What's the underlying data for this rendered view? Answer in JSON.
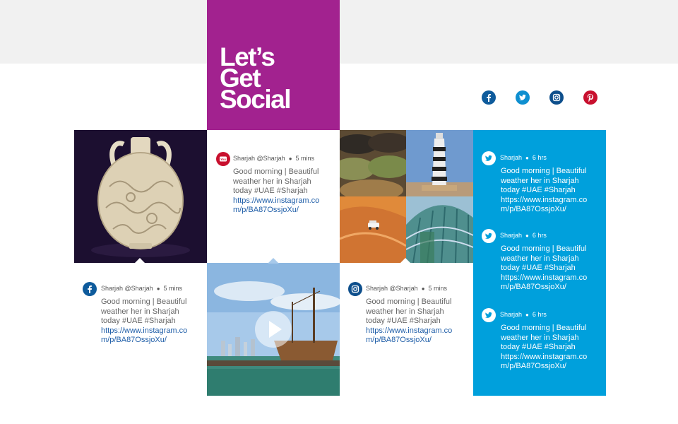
{
  "header": {
    "title_lines": [
      "Let’s",
      "Get",
      "Social"
    ]
  },
  "social_icons": [
    {
      "name": "facebook-icon",
      "color": "#0e5b9c"
    },
    {
      "name": "twitter-icon",
      "color": "#0e8fd0"
    },
    {
      "name": "instagram-icon",
      "color": "#0e4f8c"
    },
    {
      "name": "pinterest-icon",
      "color": "#c8102e"
    }
  ],
  "colors": {
    "title_block": "#a2228f",
    "twitter_panel": "#00a0dc",
    "link": "#1f5ea8"
  },
  "posts": {
    "youtube": {
      "author": "Sharjah @Sharjah",
      "time": "5 mins",
      "message": "Good morning | Beautiful weather her in Sharjah today #UAE #Sharjah",
      "link": "https://www.instagram.com/p/BA87OssjoXu/"
    },
    "facebook": {
      "author": "Sharjah @Sharjah",
      "time": "5 mins",
      "message": "Good morning | Beautiful weather her in Sharjah today #UAE #Sharjah",
      "link": "https://www.instagram.com/p/BA87OssjoXu/"
    },
    "instagram": {
      "author": "Sharjah @Sharjah",
      "time": "5 mins",
      "message": "Good morning | Beautiful weather her in Sharjah today #UAE #Sharjah",
      "link": "https://www.instagram.com/p/BA87OssjoXu/"
    }
  },
  "tweets": [
    {
      "author": "Sharjah",
      "time": "6 hrs",
      "message": "Good morning | Beautiful weather her in Sharjah today #UAE #Sharjah",
      "link": "https://www.instagram.com/p/BA87OssjoXu/"
    },
    {
      "author": "Sharjah",
      "time": "6 hrs",
      "message": "Good morning | Beautiful weather her in Sharjah today #UAE #Sharjah",
      "link": "https://www.instagram.com/p/BA87OssjoXu/"
    },
    {
      "author": "Sharjah",
      "time": "6 hrs",
      "message": "Good morning | Beautiful weather her in Sharjah today #UAE #Sharjah",
      "link": "https://www.instagram.com/p/BA87OssjoXu/"
    }
  ],
  "media": {
    "vase_photo": "vase-image",
    "spices_photo": "spices-image",
    "lighthouse_photo": "lighthouse-image",
    "desert_photo": "desert-car-image",
    "building_photo": "building-image",
    "dhow_video": "dhow-boat-video"
  }
}
